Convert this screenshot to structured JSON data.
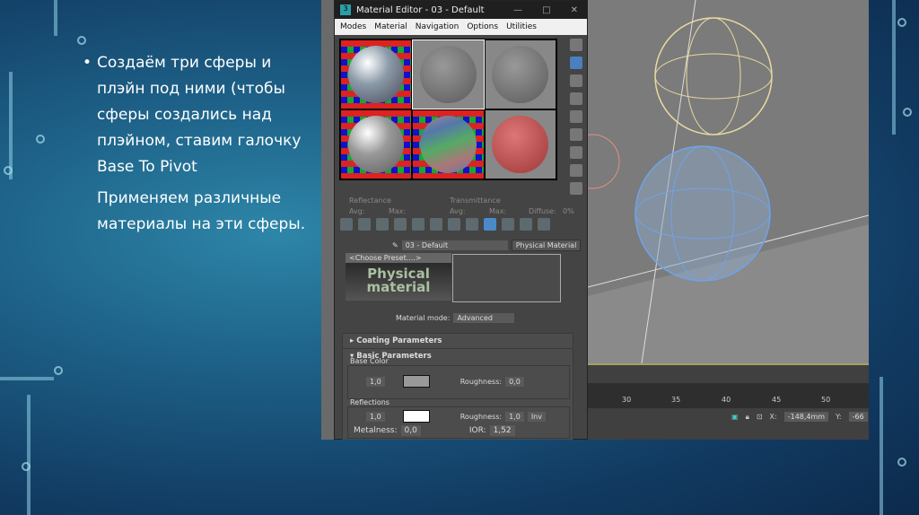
{
  "slide": {
    "bullet": "Создаём три сферы и плэйн под ними (чтобы сферы создались над плэйном, ставим галочку  Base To Pivot",
    "paragraph": "Применяем различные материалы на эти сферы."
  },
  "editor": {
    "title": "Material Editor - 03 - Default",
    "app_icon": "3",
    "menu": [
      "Modes",
      "Material",
      "Navigation",
      "Options",
      "Utilities"
    ],
    "reflectance": {
      "label": "Reflectance",
      "avg": "Avg:",
      "max": "Max:"
    },
    "transmittance": {
      "label": "Transmittance",
      "avg": "Avg:",
      "max": "Max:",
      "diffuse": "Diffuse:",
      "diffuse_val": "0%"
    },
    "material_name": "03 - Default",
    "material_type": "Physical Material",
    "preset": "<Choose Preset....>",
    "logo_text": "Physical material",
    "mode_label": "Material mode:",
    "mode_value": "Advanced",
    "coating": "Coating Parameters",
    "basic": "Basic Parameters",
    "base_color": {
      "label": "Base Color",
      "weight": "1,0",
      "roughness_label": "Roughness:",
      "roughness": "0,0"
    },
    "reflections": {
      "label": "Reflections",
      "weight": "1,0",
      "roughness_label": "Roughness:",
      "roughness": "1,0",
      "inv": "Inv",
      "metalness_label": "Metalness:",
      "metalness": "0,0",
      "ior_label": "IOR:",
      "ior": "1,52"
    }
  },
  "timeline": {
    "ticks": [
      "30",
      "35",
      "40",
      "45",
      "50"
    ]
  },
  "status": {
    "x_label": "X:",
    "x_value": "-148,4mm",
    "y_label": "Y:",
    "y_value": "-66"
  }
}
